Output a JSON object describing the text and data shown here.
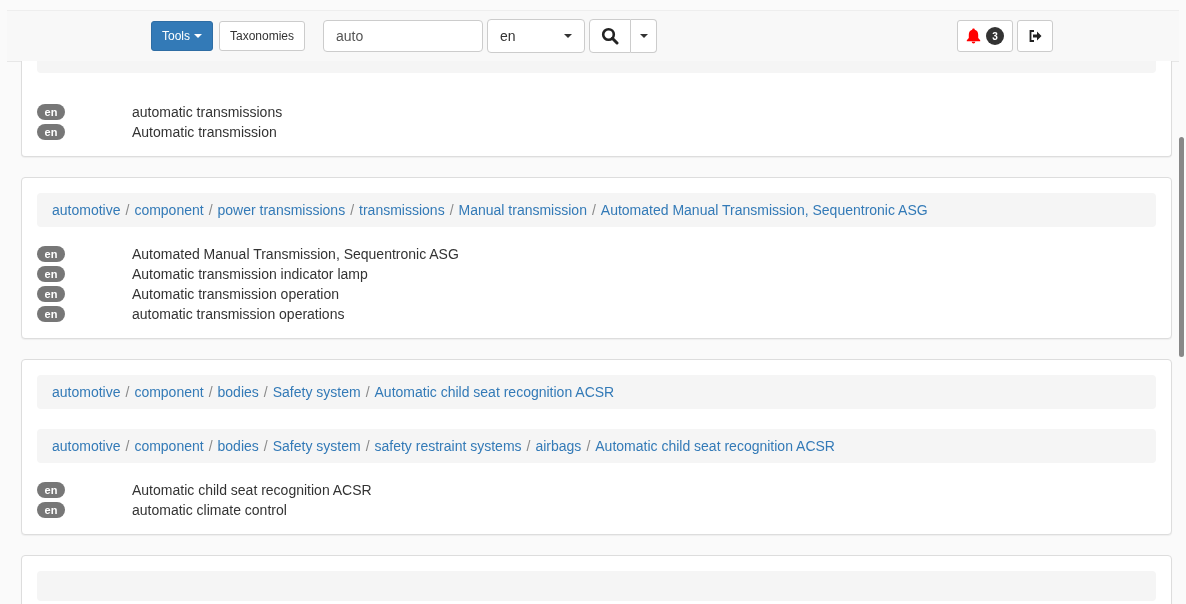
{
  "navbar": {
    "tools_button": "Tools",
    "taxonomies_button": "Taxonomies",
    "search_value": "auto",
    "language": "en",
    "notification_count": "3"
  },
  "separator": "/",
  "cards": [
    {
      "terms": [
        {
          "lang": "en",
          "text": "automatic transmissions"
        },
        {
          "lang": "en",
          "text": "Automatic transmission"
        }
      ]
    },
    {
      "breadcrumbs": [
        [
          "automotive",
          "component",
          "power transmissions",
          "transmissions",
          "Manual transmission",
          "Automated Manual Transmission, Sequentronic ASG"
        ]
      ],
      "terms": [
        {
          "lang": "en",
          "text": "Automated Manual Transmission, Sequentronic ASG"
        },
        {
          "lang": "en",
          "text": "Automatic transmission indicator lamp"
        },
        {
          "lang": "en",
          "text": "Automatic transmission operation"
        },
        {
          "lang": "en",
          "text": "automatic transmission operations"
        }
      ]
    },
    {
      "breadcrumbs": [
        [
          "automotive",
          "component",
          "bodies",
          "Safety system",
          "Automatic child seat recognition ACSR"
        ],
        [
          "automotive",
          "component",
          "bodies",
          "Safety system",
          "safety restraint systems",
          "airbags",
          "Automatic child seat recognition ACSR"
        ]
      ],
      "terms": [
        {
          "lang": "en",
          "text": "Automatic child seat recognition ACSR"
        },
        {
          "lang": "en",
          "text": "automatic climate control"
        }
      ]
    }
  ]
}
